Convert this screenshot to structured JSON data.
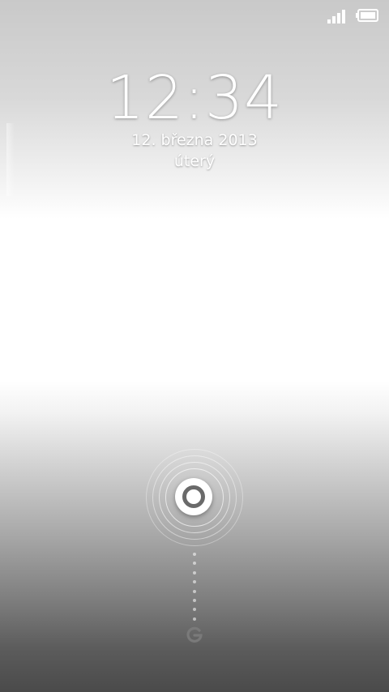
{
  "status_bar": {
    "signal_icon": "signal-icon",
    "battery_icon": "battery-icon"
  },
  "lock": {
    "time": "12:34",
    "date": "12. března 2013",
    "weekday": "úterý"
  },
  "unlock": {
    "handle_icon": "unlock-ring-icon",
    "bottom_icon": "google-search-icon"
  }
}
